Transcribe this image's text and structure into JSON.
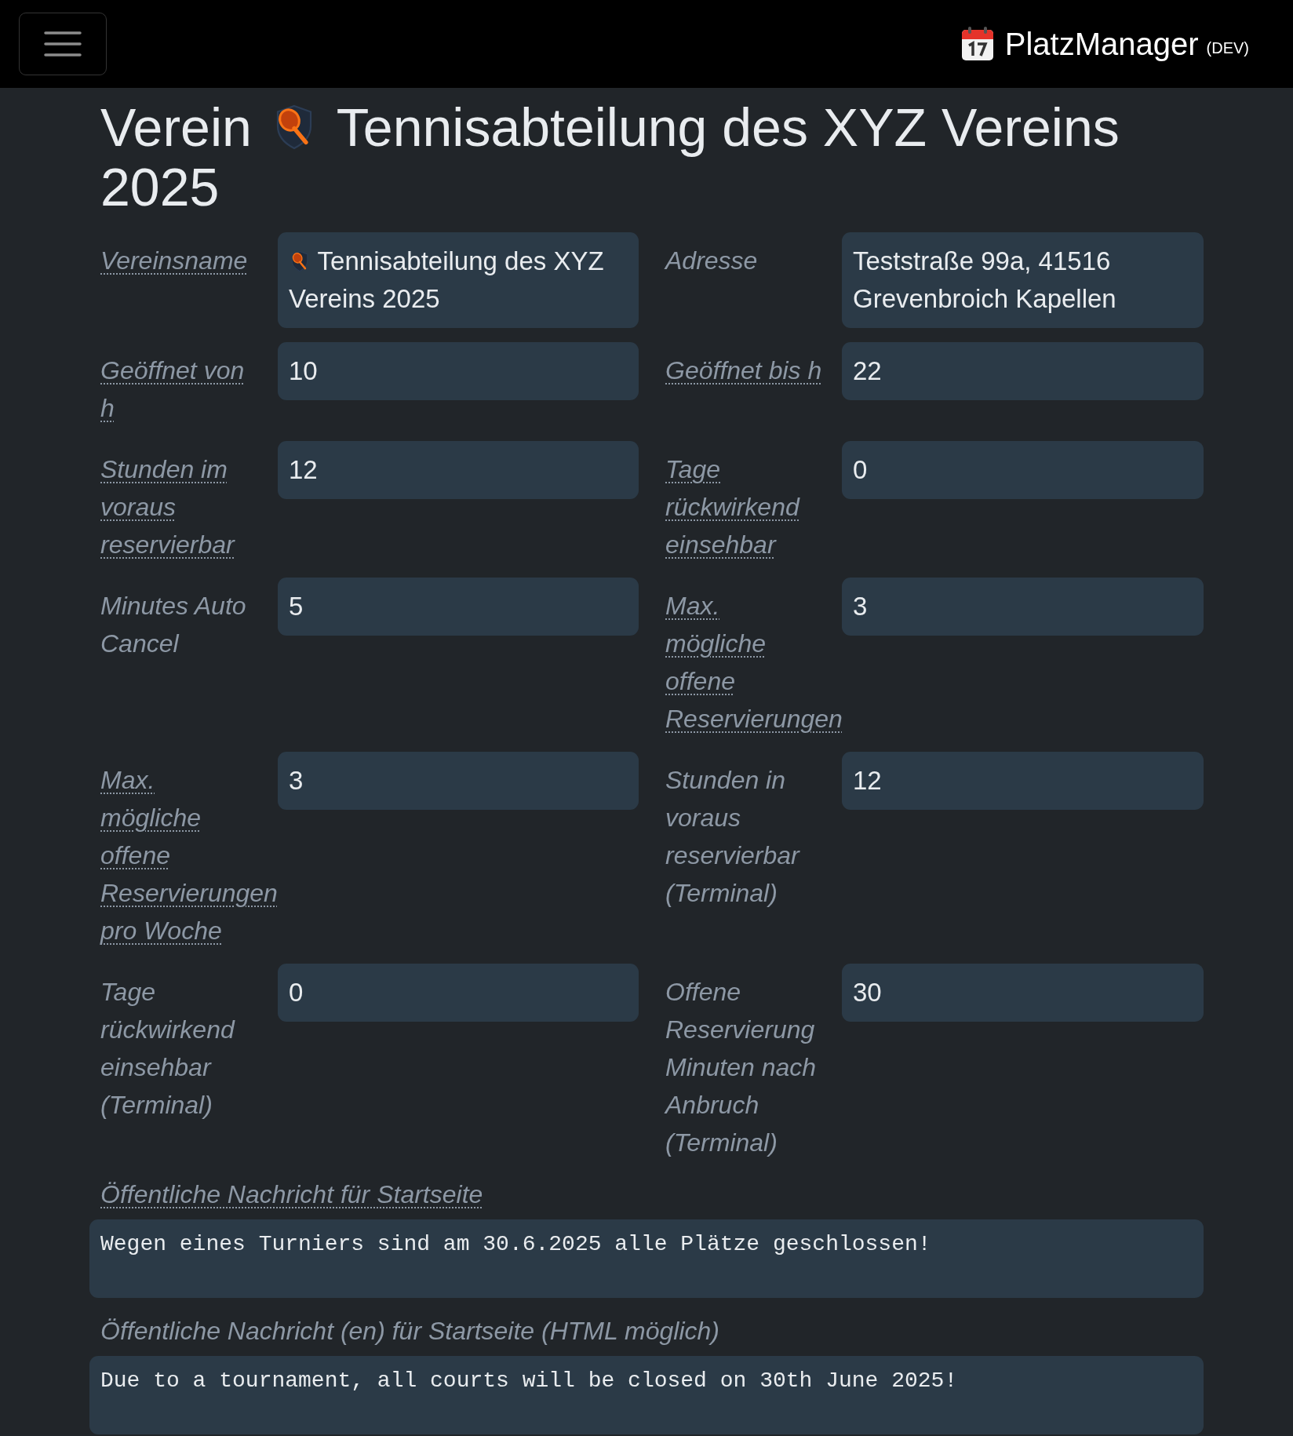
{
  "navbar": {
    "brand": "PlatzManager",
    "badge": "(DEV)"
  },
  "heading": {
    "prefix": "Verein",
    "name": "Tennisabteilung des XYZ Vereins",
    "suffix": "2025"
  },
  "fields": [
    {
      "label": "Vereinsname",
      "tooltip": true,
      "value": "Tennisabteilung des XYZ Vereins 2025",
      "logo": true
    },
    {
      "label": "Adresse",
      "tooltip": false,
      "value": "Teststraße 99a, 41516 Grevenbroich Kapellen",
      "logo": false
    },
    {
      "label": "Geöffnet von h",
      "tooltip": true,
      "value": "10",
      "logo": false
    },
    {
      "label": "Geöffnet bis h",
      "tooltip": true,
      "value": "22",
      "logo": false
    },
    {
      "label": "Stunden im voraus reservierbar",
      "tooltip": true,
      "value": "12",
      "logo": false
    },
    {
      "label": "Tage rückwirkend einsehbar",
      "tooltip": true,
      "value": "0",
      "logo": false
    },
    {
      "label": "Minutes Auto Cancel",
      "tooltip": false,
      "value": "5",
      "logo": false
    },
    {
      "label": "Max. mögliche offene Reservierungen",
      "tooltip": true,
      "value": "3",
      "logo": false
    },
    {
      "label": "Max. mögliche offene Reservierungen pro Woche",
      "tooltip": true,
      "value": "3",
      "logo": false
    },
    {
      "label": "Stunden in voraus reservierbar (Terminal)",
      "tooltip": false,
      "value": "12",
      "logo": false
    },
    {
      "label": "Tage rückwirkend einsehbar (Terminal)",
      "tooltip": false,
      "value": "0",
      "logo": false
    },
    {
      "label": "Offene Reservierung Minuten nach Anbruch (Terminal)",
      "tooltip": false,
      "value": "30",
      "logo": false
    }
  ],
  "messages": [
    {
      "label": "Öffentliche Nachricht für Startseite",
      "tooltip": true,
      "value": "Wegen eines Turniers sind am 30.6.2025 alle Plätze geschlossen!"
    },
    {
      "label": "Öffentliche Nachricht (en) für Startseite (HTML möglich)",
      "tooltip": false,
      "value": "Due to a tournament, all courts will be closed on 30th June 2025!"
    }
  ]
}
